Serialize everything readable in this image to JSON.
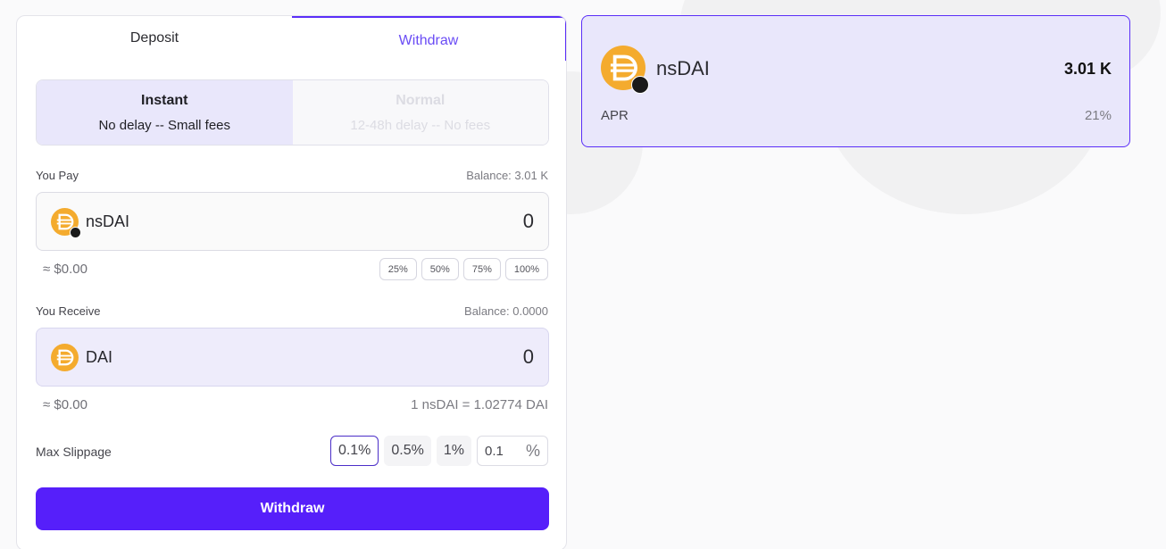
{
  "tabs": {
    "deposit": "Deposit",
    "withdraw": "Withdraw"
  },
  "mode": {
    "instant": {
      "title": "Instant",
      "subtitle": "No delay -- Small fees"
    },
    "normal": {
      "title": "Normal",
      "subtitle": "12-48h delay -- No fees"
    }
  },
  "pay": {
    "label": "You Pay",
    "balance": "Balance: 3.01 K",
    "token": "nsDAI",
    "amount": "0",
    "usd": "≈ $0.00",
    "percent_options": [
      "25%",
      "50%",
      "75%",
      "100%"
    ]
  },
  "receive": {
    "label": "You Receive",
    "balance": "Balance: 0.0000",
    "token": "DAI",
    "amount": "0",
    "usd": "≈ $0.00",
    "rate": "1 nsDAI = 1.02774 DAI"
  },
  "slippage": {
    "label": "Max Slippage",
    "options": [
      "0.1%",
      "0.5%",
      "1%"
    ],
    "selected": "0.1%",
    "custom_value": "0.1",
    "unit": "%"
  },
  "action": {
    "label": "Withdraw"
  },
  "card": {
    "token": "nsDAI",
    "balance": "3.01 K",
    "apr_label": "APR",
    "apr_value": "21%"
  },
  "colors": {
    "accent": "#561ffa",
    "active_bg": "#e9e7fb",
    "coin": "#f4ab2e"
  }
}
